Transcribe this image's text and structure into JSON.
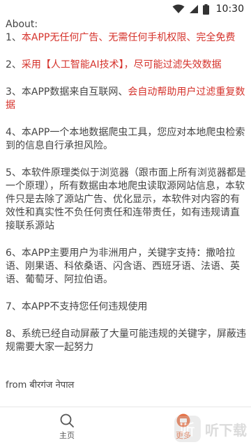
{
  "status_bar": {
    "time": "10:30"
  },
  "content": {
    "about_title": "About:",
    "items": [
      {
        "segments": [
          {
            "text": "1、",
            "color": "normal"
          },
          {
            "text": "本APP无任何广告、无需任何手机权限、完全免费",
            "color": "red"
          }
        ]
      },
      {
        "segments": [
          {
            "text": "2、",
            "color": "normal"
          },
          {
            "text": "采用【人工智能AI技术】，尽可能过滤失效数据",
            "color": "red"
          }
        ]
      },
      {
        "segments": [
          {
            "text": "3、本APP数据来自互联网、",
            "color": "normal"
          },
          {
            "text": "会自动帮助用户过滤重复数据",
            "color": "red"
          }
        ]
      },
      {
        "segments": [
          {
            "text": "4、本APP一个本地数据爬虫工具，您应对本地爬虫检索到的信息自行承担风险。",
            "color": "normal"
          }
        ]
      },
      {
        "segments": [
          {
            "text": "5、本软件原理类似于浏览器（跟市面上所有浏览器都是一个原理），所有数据由本地爬虫读取源网站信息，本软件只是去除了源站广告、优化显示，本软件对内容的有效性和真实性不负任何责任和连带责任，如有违规请直接联系源站",
            "color": "normal"
          }
        ]
      },
      {
        "segments": [
          {
            "text": "6、本APP主要用户为非洲用户，关键字支持：撒哈拉语、刚果语、科依桑语、闪含语、西班牙语、法语、英语、葡萄牙、阿拉伯语。",
            "color": "normal"
          }
        ]
      },
      {
        "segments": [
          {
            "text": "7、本APP不支持您任何违规使用",
            "color": "normal"
          }
        ]
      },
      {
        "segments": [
          {
            "text": "8、系统已经自动屏蔽了大量可能违规的关键字，屏蔽违规需要大家一起努力",
            "color": "normal"
          }
        ]
      }
    ],
    "from_text": "from बीरगंज नेपाल"
  },
  "bottom_nav": {
    "items": [
      {
        "label": "主页",
        "icon": "search-icon"
      },
      {
        "label": "更多",
        "icon": "more-icon",
        "active": true
      }
    ]
  },
  "watermark": {
    "badge": "听",
    "text": "听下载"
  },
  "colors": {
    "accent_red": "#d5322b",
    "active_nav": "#e76a3c"
  }
}
